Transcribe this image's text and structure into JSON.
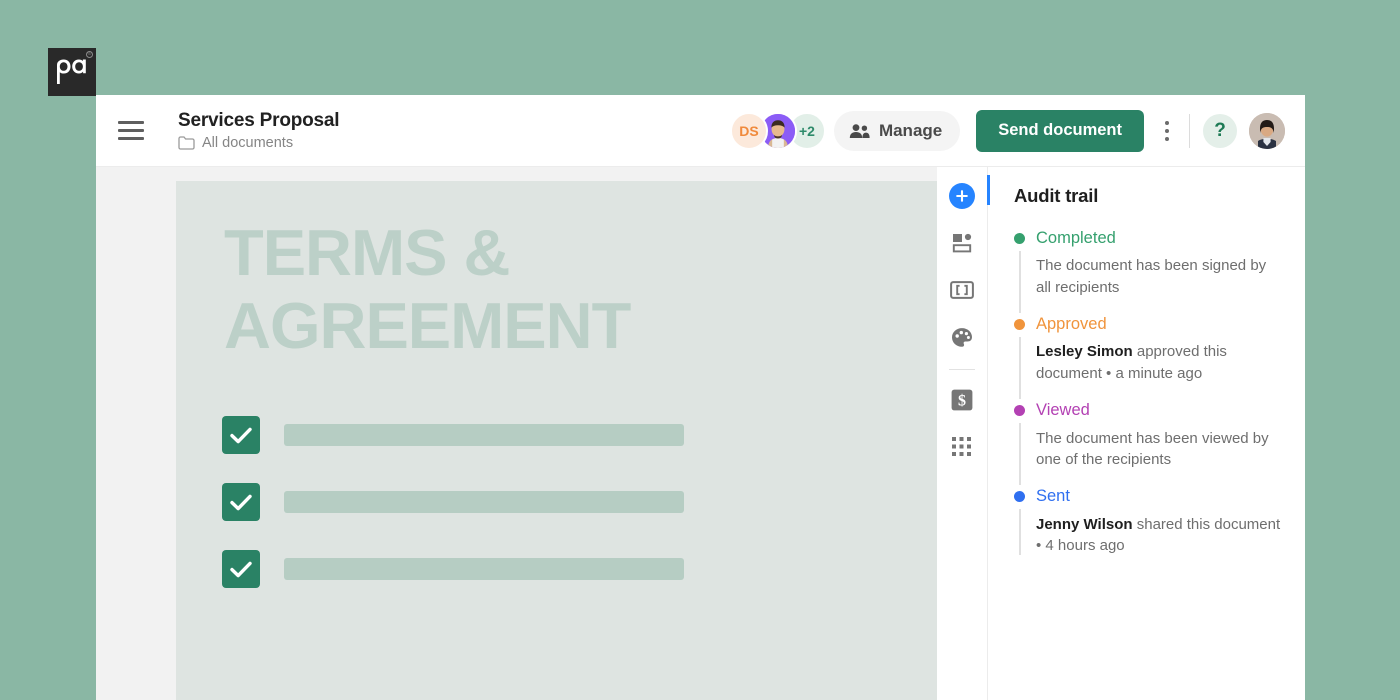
{
  "brand": {
    "logo_text": "pd",
    "logo_registered": "®",
    "logo_bg": "#292929"
  },
  "colors": {
    "page_bg": "#8AB7A4",
    "accent_green": "#2A8265",
    "accent_blue": "#2684FF",
    "doc_page": "#DEE4E1",
    "doc_heading": "#BCD0C8",
    "status_completed": "#35A06E",
    "status_approved": "#F0943C",
    "status_viewed": "#B341B3",
    "status_sent": "#2F6FF0"
  },
  "header": {
    "menu_icon": "hamburger-icon",
    "title": "Services Proposal",
    "breadcrumb_icon": "folder-icon",
    "breadcrumb": "All documents",
    "avatars": [
      {
        "type": "initials",
        "label": "DS",
        "bg": "#FCE9DB",
        "fg": "#F08A3C"
      },
      {
        "type": "photo",
        "label": "",
        "bg": "#8B5CF6",
        "fg": "#ffffff"
      },
      {
        "type": "count",
        "label": "+2",
        "bg": "#E2EFE8",
        "fg": "#2E8B6B"
      }
    ],
    "manage_icon": "people-icon",
    "manage_label": "Manage",
    "send_label": "Send document",
    "kebab_icon": "more-vertical-icon",
    "help_label": "?",
    "user_avatar_icon": "user-avatar"
  },
  "document": {
    "heading": "TERMS & AGREEMENT",
    "checklist": [
      {
        "checked": true,
        "icon": "checkmark-icon",
        "placeholder_width": 400
      },
      {
        "checked": true,
        "icon": "checkmark-icon",
        "placeholder_width": 400
      },
      {
        "checked": true,
        "icon": "checkmark-icon",
        "placeholder_width": 400
      }
    ]
  },
  "tool_rail": {
    "tools": [
      {
        "name": "add-block-button",
        "icon": "plus-circle-icon"
      },
      {
        "name": "content-library-button",
        "icon": "content-blocks-icon"
      },
      {
        "name": "fields-button",
        "icon": "field-token-icon"
      },
      {
        "name": "theme-button",
        "icon": "palette-icon"
      },
      {
        "name": "pricing-button",
        "icon": "dollar-square-icon"
      },
      {
        "name": "apps-button",
        "icon": "grid-dots-icon"
      }
    ]
  },
  "audit_trail": {
    "title": "Audit trail",
    "entries": [
      {
        "status": "Completed",
        "color": "#35A06E",
        "actor": "",
        "description": "The document has been signed by all recipients"
      },
      {
        "status": "Approved",
        "color": "#F0943C",
        "actor": "Lesley Simon",
        "description": " approved this document • a minute ago"
      },
      {
        "status": "Viewed",
        "color": "#B341B3",
        "actor": "",
        "description": "The document has been viewed by one of the recipients"
      },
      {
        "status": "Sent",
        "color": "#2F6FF0",
        "actor": "Jenny Wilson",
        "description": " shared this document • 4 hours ago"
      }
    ]
  }
}
